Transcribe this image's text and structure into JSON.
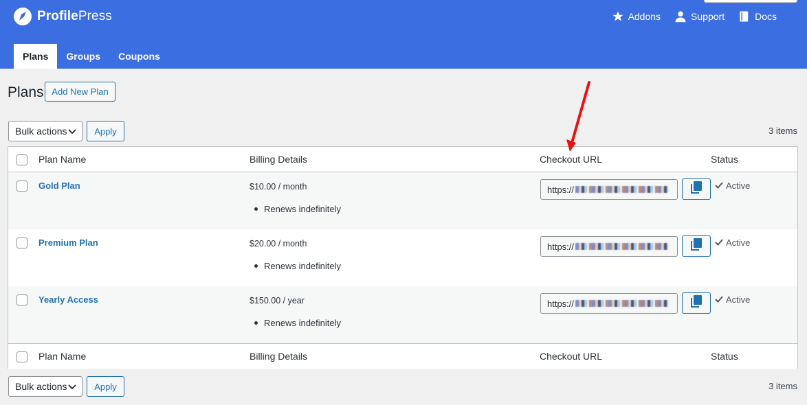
{
  "header": {
    "brand_bold": "Profile",
    "brand_rest": "Press",
    "links": [
      {
        "label": "Addons",
        "icon": "star-icon"
      },
      {
        "label": "Support",
        "icon": "user-icon"
      },
      {
        "label": "Docs",
        "icon": "book-icon"
      }
    ],
    "tabs": [
      {
        "label": "Plans",
        "active": true
      },
      {
        "label": "Groups",
        "active": false
      },
      {
        "label": "Coupons",
        "active": false
      }
    ],
    "accent": "#3b6ee0"
  },
  "page": {
    "title": "Plans",
    "add_new_label": "Add New Plan"
  },
  "toolbar": {
    "bulk_label": "Bulk actions",
    "apply_label": "Apply",
    "count": "3 items"
  },
  "table": {
    "columns": [
      "Plan Name",
      "Billing Details",
      "Checkout URL",
      "Status"
    ],
    "rows": [
      {
        "name": "Gold Plan",
        "price": "$10.00 / month",
        "renewal": "Renews indefinitely",
        "url_prefix": "https://",
        "status": "Active"
      },
      {
        "name": "Premium Plan",
        "price": "$20.00 / month",
        "renewal": "Renews indefinitely",
        "url_prefix": "https://",
        "status": "Active"
      },
      {
        "name": "Yearly Access",
        "price": "$150.00 / year",
        "renewal": "Renews indefinitely",
        "url_prefix": "https://",
        "status": "Active"
      }
    ]
  },
  "colors": {
    "link": "#2271b1",
    "annotation_arrow": "#e8130f"
  }
}
